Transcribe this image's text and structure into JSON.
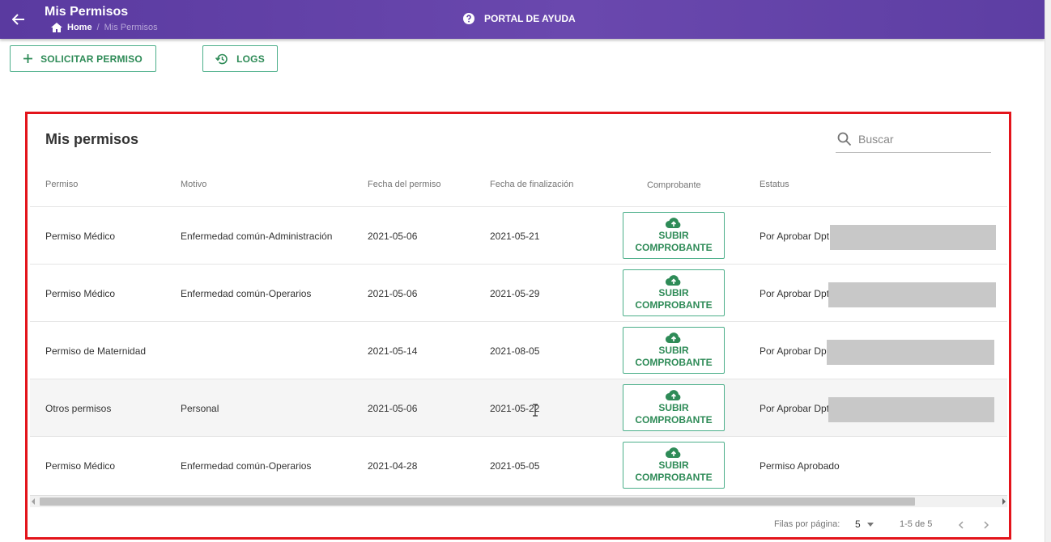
{
  "header": {
    "title": "Mis Permisos",
    "breadcrumb_home": "Home",
    "breadcrumb_separator": "/",
    "breadcrumb_current": "Mis Permisos",
    "help_label": "PORTAL DE AYUDA",
    "back_icon": "arrow-left-icon",
    "home_icon": "home-icon",
    "help_icon": "help-circle-icon"
  },
  "toolbar": {
    "request_label": "SOLICITAR PERMISO",
    "request_icon": "plus-icon",
    "logs_label": "LOGS",
    "logs_icon": "history-icon"
  },
  "card": {
    "title": "Mis permisos",
    "search_placeholder": "Buscar",
    "search_icon": "search-icon"
  },
  "table": {
    "columns": [
      "Permiso",
      "Motivo",
      "Fecha del permiso",
      "Fecha de finalización",
      "Comprobante",
      "Estatus"
    ],
    "upload_label_line1": "SUBIR",
    "upload_label_line2": "COMPROBANTE",
    "upload_icon": "cloud-upload-icon",
    "rows": [
      {
        "permiso": "Permiso Médico",
        "motivo": "Enfermedad común-Administración",
        "fecha": "2021-05-06",
        "fin": "2021-05-21",
        "estatus": "Por Aprobar Dpt",
        "redacted": true
      },
      {
        "permiso": "Permiso Médico",
        "motivo": "Enfermedad común-Operarios",
        "fecha": "2021-05-06",
        "fin": "2021-05-29",
        "estatus": "Por Aprobar Dpt",
        "redacted": true
      },
      {
        "permiso": "Permiso de Maternidad",
        "motivo": "",
        "fecha": "2021-05-14",
        "fin": "2021-08-05",
        "estatus": "Por Aprobar Dpt",
        "redacted": true
      },
      {
        "permiso": "Otros permisos",
        "motivo": "Personal",
        "fecha": "2021-05-06",
        "fin": "2021-05-22",
        "estatus": "Por Aprobar Dpt",
        "redacted": true
      },
      {
        "permiso": "Permiso Médico",
        "motivo": "Enfermedad común-Operarios",
        "fecha": "2021-04-28",
        "fin": "2021-05-05",
        "estatus": "Permiso Aprobado",
        "redacted": false
      }
    ]
  },
  "pagination": {
    "rows_per_page_label": "Filas por página:",
    "rows_per_page_value": "5",
    "range_label": "1-5 de 5",
    "prev_icon": "chevron-left-icon",
    "next_icon": "chevron-right-icon"
  },
  "colors": {
    "header_bg": "#5f40a6",
    "accent_green": "#2e8b57",
    "highlight_red": "#e3141b"
  }
}
